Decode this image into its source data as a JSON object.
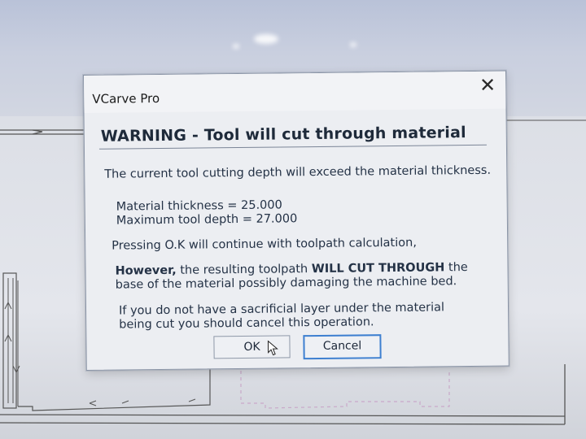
{
  "dialog": {
    "title": "VCarve Pro",
    "close_label": "✕",
    "heading": "WARNING - Tool will cut through material",
    "intro": "The current tool cutting depth will exceed the material thickness.",
    "material_thickness": "Material thickness = 25.000",
    "max_tool_depth": "Maximum tool depth = 27.000",
    "continue_text": "Pressing O.K will continue with toolpath calculation,",
    "however_bold": "However,",
    "however_mid": " the resulting toolpath ",
    "will_cut_bold": "WILL CUT THROUGH",
    "however_end": " the",
    "however_line2": "base of the material possibly damaging the machine bed.",
    "sacrificial_line1": "If you do not have a sacrificial layer under the material",
    "sacrificial_line2": "being cut you should cancel this operation.",
    "ok_label": "OK",
    "cancel_label": "Cancel"
  },
  "icons": {
    "close": "close-icon",
    "cursor": "mouse-cursor-icon"
  },
  "colors": {
    "focus_border": "#3d7fd0",
    "text": "#243246"
  }
}
